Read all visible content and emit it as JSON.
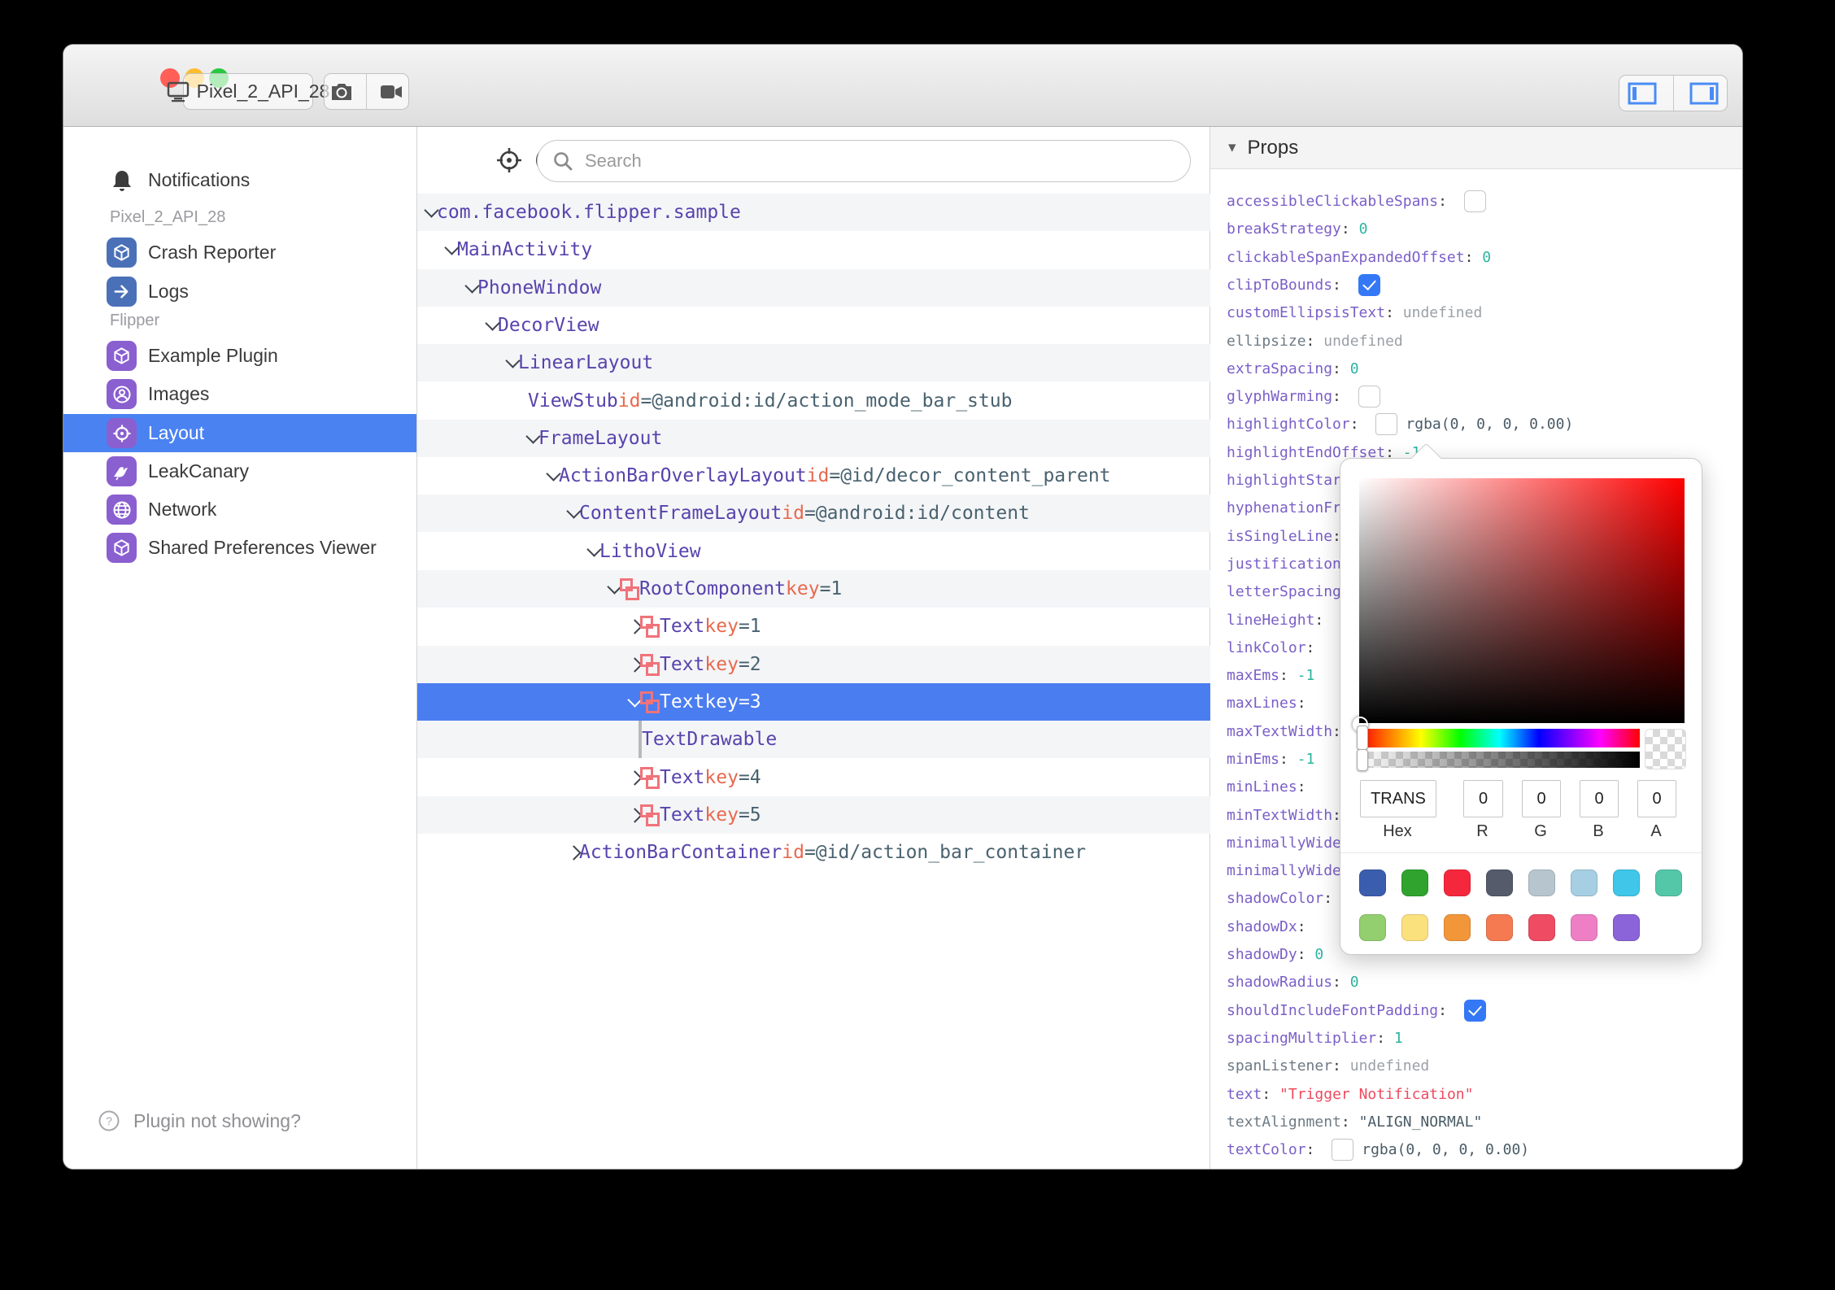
{
  "titlebar": {
    "device_button": "Pixel_2_API_28",
    "traffic": {
      "red": "#ff5f57",
      "yellow": "#febc2e",
      "green": "#28c840"
    },
    "buttons": [
      "screenshot-camera",
      "screen-record-video"
    ],
    "panel_toggles": [
      "toggle-left-sidebar",
      "toggle-right-sidebar"
    ],
    "toggle_accent": "#4a8cf5"
  },
  "sidebar": {
    "top_item": {
      "label": "Notifications",
      "icon": "bell-icon"
    },
    "sections": [
      {
        "header": "Pixel_2_API_28",
        "items": [
          {
            "label": "Crash Reporter",
            "icon": "cube-icon",
            "color": "#4a71b8",
            "selected": false
          },
          {
            "label": "Logs",
            "icon": "arrow-right-icon",
            "color": "#4a71b8",
            "selected": false
          }
        ]
      },
      {
        "header": "Flipper",
        "items": [
          {
            "label": "Example Plugin",
            "icon": "cube-icon",
            "color": "#8a5fd0",
            "selected": false
          },
          {
            "label": "Images",
            "icon": "user-circle-icon",
            "color": "#8a5fd0",
            "selected": false
          },
          {
            "label": "Layout",
            "icon": "target-icon",
            "color": "#8a5fd0",
            "selected": true
          },
          {
            "label": "LeakCanary",
            "icon": "bird-icon",
            "color": "#8a5fd0",
            "selected": false
          },
          {
            "label": "Network",
            "icon": "globe-icon",
            "color": "#8a5fd0",
            "selected": false
          },
          {
            "label": "Shared Preferences Viewer",
            "icon": "cube-icon",
            "color": "#8a5fd0",
            "selected": false
          }
        ]
      }
    ],
    "footer": {
      "label": "Plugin not showing?",
      "icon": "help-circle-icon"
    },
    "selected_color": "#4a82f2"
  },
  "inspector": {
    "toolbar_icons": [
      "target-icon",
      "accessibility-icon",
      "marquee-select-icon"
    ],
    "search_placeholder": "Search",
    "tree": [
      {
        "level": 0,
        "expand": "open",
        "litho": false,
        "name": "com.facebook.flipper.sample",
        "attr": null,
        "selected": false
      },
      {
        "level": 1,
        "expand": "open",
        "litho": false,
        "name": "MainActivity",
        "attr": null,
        "selected": false
      },
      {
        "level": 2,
        "expand": "open",
        "litho": false,
        "name": "PhoneWindow",
        "attr": null,
        "selected": false
      },
      {
        "level": 3,
        "expand": "open",
        "litho": false,
        "name": "DecorView",
        "attr": null,
        "selected": false
      },
      {
        "level": 4,
        "expand": "open",
        "litho": false,
        "name": "LinearLayout",
        "attr": null,
        "selected": false
      },
      {
        "level": 5,
        "expand": "none",
        "litho": false,
        "name": "ViewStub",
        "attr": {
          "key": "id",
          "value": "@android:id/action_mode_bar_stub"
        },
        "selected": false
      },
      {
        "level": 5,
        "expand": "open",
        "litho": false,
        "name": "FrameLayout",
        "attr": null,
        "selected": false
      },
      {
        "level": 6,
        "expand": "open",
        "litho": false,
        "name": "ActionBarOverlayLayout",
        "attr": {
          "key": "id",
          "value": "@id/decor_content_parent"
        },
        "selected": false
      },
      {
        "level": 7,
        "expand": "open",
        "litho": false,
        "name": "ContentFrameLayout",
        "attr": {
          "key": "id",
          "value": "@android:id/content"
        },
        "selected": false
      },
      {
        "level": 8,
        "expand": "open",
        "litho": false,
        "name": "LithoView",
        "attr": null,
        "selected": false
      },
      {
        "level": 9,
        "expand": "open",
        "litho": true,
        "name": "RootComponent",
        "attr": {
          "key": "key",
          "value": "1"
        },
        "selected": false
      },
      {
        "level": 10,
        "expand": "closed",
        "litho": true,
        "name": "Text",
        "attr": {
          "key": "key",
          "value": "1"
        },
        "selected": false
      },
      {
        "level": 10,
        "expand": "closed",
        "litho": true,
        "name": "Text",
        "attr": {
          "key": "key",
          "value": "2"
        },
        "selected": false
      },
      {
        "level": 10,
        "expand": "open",
        "litho": true,
        "name": "Text",
        "attr": {
          "key": "key",
          "value": "3"
        },
        "selected": true
      },
      {
        "level": 11,
        "expand": "bar",
        "litho": false,
        "name": "TextDrawable",
        "attr": null,
        "selected": false
      },
      {
        "level": 10,
        "expand": "closed",
        "litho": true,
        "name": "Text",
        "attr": {
          "key": "key",
          "value": "4"
        },
        "selected": false
      },
      {
        "level": 10,
        "expand": "closed",
        "litho": true,
        "name": "Text",
        "attr": {
          "key": "key",
          "value": "5"
        },
        "selected": false
      },
      {
        "level": 7,
        "expand": "closed",
        "litho": false,
        "name": "ActionBarContainer",
        "attr": {
          "key": "id",
          "value": "@id/action_bar_container"
        },
        "selected": false
      }
    ]
  },
  "props": {
    "title": "Props",
    "rows": [
      {
        "key": "accessibleClickableSpans",
        "key_style": "purple",
        "control": "checkbox-unchecked",
        "value": "",
        "value_style": "teal"
      },
      {
        "key": "breakStrategy",
        "key_style": "purple",
        "control": null,
        "value": "0",
        "value_style": "teal"
      },
      {
        "key": "clickableSpanExpandedOffset",
        "key_style": "purple",
        "control": null,
        "value": "0",
        "value_style": "teal"
      },
      {
        "key": "clipToBounds",
        "key_style": "purple",
        "control": "checkbox-checked",
        "value": "",
        "value_style": "teal"
      },
      {
        "key": "customEllipsisText",
        "key_style": "purple",
        "control": null,
        "value": "undefined",
        "value_style": "gray"
      },
      {
        "key": "ellipsize",
        "key_style": "gray",
        "control": null,
        "value": "undefined",
        "value_style": "gray"
      },
      {
        "key": "extraSpacing",
        "key_style": "purple",
        "control": null,
        "value": "0",
        "value_style": "teal"
      },
      {
        "key": "glyphWarming",
        "key_style": "purple",
        "control": "checkbox-unchecked",
        "value": "",
        "value_style": "teal"
      },
      {
        "key": "highlightColor",
        "key_style": "purple",
        "control": "color-swatch",
        "value": "rgba(0, 0, 0, 0.00)",
        "value_style": "slate"
      },
      {
        "key": "highlightEndOffset",
        "key_style": "purple",
        "control": null,
        "value": "-1",
        "value_style": "teal"
      },
      {
        "key": "highlightStartOffset",
        "key_style": "purple",
        "control": null,
        "value": "",
        "value_style": "teal"
      },
      {
        "key": "hyphenationFrequency",
        "key_style": "purple",
        "control": null,
        "value": "",
        "value_style": "teal"
      },
      {
        "key": "isSingleLine",
        "key_style": "purple",
        "control": null,
        "value": "",
        "value_style": "teal"
      },
      {
        "key": "justificationMode",
        "key_style": "purple",
        "control": null,
        "value": "",
        "value_style": "teal"
      },
      {
        "key": "letterSpacing",
        "key_style": "purple",
        "control": null,
        "value": "",
        "value_style": "teal"
      },
      {
        "key": "lineHeight",
        "key_style": "purple",
        "control": null,
        "value": "",
        "value_style": "teal"
      },
      {
        "key": "linkColor",
        "key_style": "purple",
        "control": null,
        "value": "",
        "value_style": "teal"
      },
      {
        "key": "maxEms",
        "key_style": "purple",
        "control": null,
        "value": "-1",
        "value_style": "teal"
      },
      {
        "key": "maxLines",
        "key_style": "purple",
        "control": null,
        "value": "",
        "value_style": "teal"
      },
      {
        "key": "maxTextWidth",
        "key_style": "purple",
        "control": null,
        "value": "",
        "value_style": "teal"
      },
      {
        "key": "minEms",
        "key_style": "purple",
        "control": null,
        "value": "-1",
        "value_style": "teal"
      },
      {
        "key": "minLines",
        "key_style": "purple",
        "control": null,
        "value": "",
        "value_style": "teal"
      },
      {
        "key": "minTextWidth",
        "key_style": "purple",
        "control": null,
        "value": "",
        "value_style": "teal"
      },
      {
        "key": "minimallyWide",
        "key_style": "purple",
        "control": null,
        "value": "",
        "value_style": "teal"
      },
      {
        "key": "minimallyWideThreshold",
        "key_style": "purple",
        "control": null,
        "value": "",
        "value_style": "teal"
      },
      {
        "key": "shadowColor",
        "key_style": "purple",
        "control": null,
        "value": "",
        "value_style": "teal"
      },
      {
        "key": "shadowDx",
        "key_style": "purple",
        "control": null,
        "value": "",
        "value_style": "teal"
      },
      {
        "key": "shadowDy",
        "key_style": "purple",
        "control": null,
        "value": "0",
        "value_style": "teal"
      },
      {
        "key": "shadowRadius",
        "key_style": "purple",
        "control": null,
        "value": "0",
        "value_style": "teal"
      },
      {
        "key": "shouldIncludeFontPadding",
        "key_style": "purple",
        "control": "checkbox-checked",
        "value": "",
        "value_style": "teal"
      },
      {
        "key": "spacingMultiplier",
        "key_style": "purple",
        "control": null,
        "value": "1",
        "value_style": "teal"
      },
      {
        "key": "spanListener",
        "key_style": "gray",
        "control": null,
        "value": "undefined",
        "value_style": "gray"
      },
      {
        "key": "text",
        "key_style": "purple",
        "control": null,
        "value": "\"Trigger Notification\"",
        "value_style": "red"
      },
      {
        "key": "textAlignment",
        "key_style": "gray",
        "control": null,
        "value": "\"ALIGN_NORMAL\"",
        "value_style": "slate"
      },
      {
        "key": "textColor",
        "key_style": "purple",
        "control": "color-swatch",
        "value": "rgba(0, 0, 0, 0.00)",
        "value_style": "slate"
      }
    ]
  },
  "color_picker": {
    "hex": "TRANS",
    "r": "0",
    "g": "0",
    "b": "0",
    "a": "0",
    "labels": [
      "Hex",
      "R",
      "G",
      "B",
      "A"
    ],
    "swatches_row1": [
      "#3b5dae",
      "#2fa32e",
      "#f5273d",
      "#555b6b",
      "#b7c6ce",
      "#a6cfe3",
      "#3fc6e8",
      "#54c7a9"
    ],
    "swatches_row2": [
      "#93ce6f",
      "#fbe07e",
      "#f2963a",
      "#f57a51",
      "#ef4b63",
      "#ee7fc5",
      "#8a64d8"
    ]
  }
}
